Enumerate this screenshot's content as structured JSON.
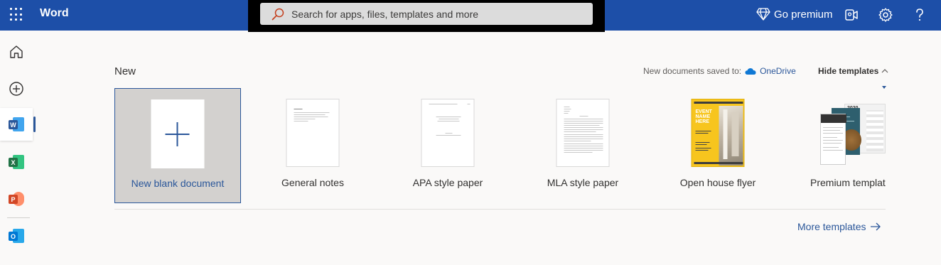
{
  "app": {
    "name": "Word"
  },
  "search": {
    "placeholder": "Search for apps, files, templates and more"
  },
  "topbar": {
    "premium_label": "Go premium"
  },
  "rail": {
    "items": [
      {
        "name": "home",
        "icon": "home-icon"
      },
      {
        "name": "create",
        "icon": "add-circle-icon"
      },
      {
        "name": "word",
        "letter": "W",
        "color": "#2b579a"
      },
      {
        "name": "excel",
        "letter": "X",
        "color": "#217346"
      },
      {
        "name": "powerpoint",
        "letter": "P",
        "color": "#d24726"
      },
      {
        "name": "outlook",
        "letter": "O",
        "color": "#0078d4"
      }
    ]
  },
  "main": {
    "heading": "New",
    "saved_to_label": "New documents saved to:",
    "saved_to_location": "OneDrive",
    "hide_templates": "Hide templates",
    "more_templates": "More templates",
    "templates": [
      {
        "label": "New blank document"
      },
      {
        "label": "General notes"
      },
      {
        "label": "APA style paper"
      },
      {
        "label": "MLA style paper"
      },
      {
        "label": "Open house flyer",
        "flyer_text": [
          "EVENT",
          "NAME",
          "HERE"
        ]
      },
      {
        "label": "Premium templat",
        "badge": "2020"
      }
    ]
  },
  "colors": {
    "brand": "#1d4fa8",
    "accent": "#2b579a",
    "flyer_yellow": "#f7c51e"
  }
}
